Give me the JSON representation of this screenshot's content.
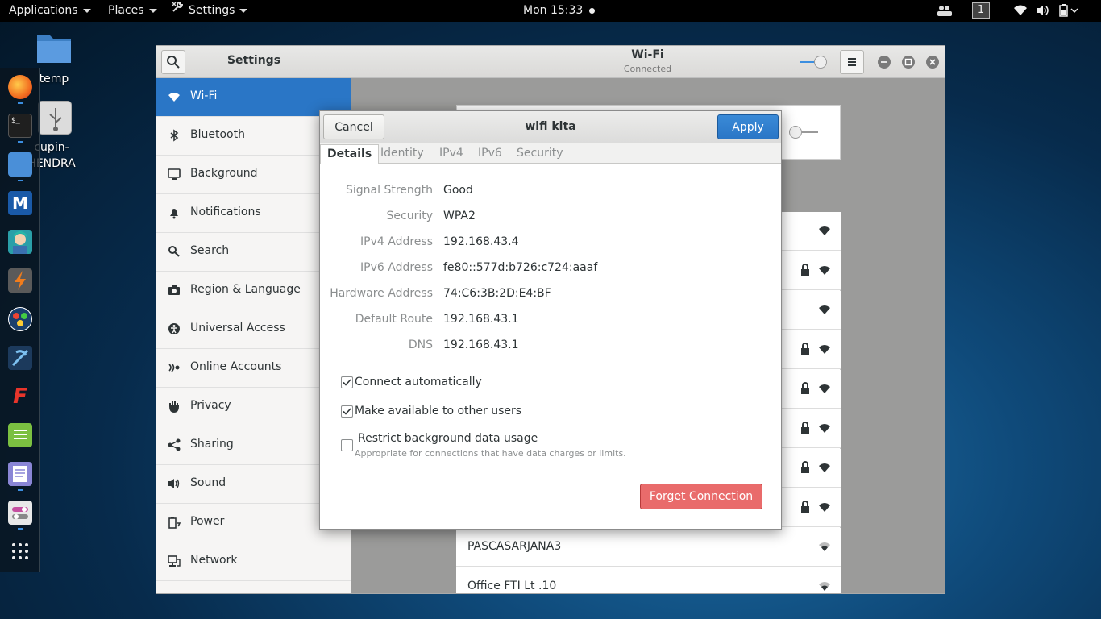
{
  "topbar": {
    "applications": "Applications",
    "places": "Places",
    "settings": "Settings",
    "clock": "Mon 15:33",
    "workspace": "1"
  },
  "desktop": {
    "icons": [
      {
        "label": "temp",
        "icon": "folder-icon"
      },
      {
        "label": "cupin-\nHENDRA",
        "icon": "usb-drive-icon"
      }
    ]
  },
  "dock": {
    "apps": [
      "firefox-icon",
      "terminal-icon",
      "files-icon",
      "metasploit-icon",
      "avatar-app-icon",
      "burp-icon",
      "maltego-icon",
      "kali-tool-icon",
      "faraday-icon",
      "notes-icon",
      "text-editor-icon",
      "tweaks-icon",
      "app-grid-icon"
    ]
  },
  "settings_window": {
    "sidebar_title": "Settings",
    "main_title": "Wi-Fi",
    "main_subtitle": "Connected",
    "sidebar_items": [
      {
        "label": "Wi-Fi",
        "icon": "wifi-icon",
        "active": true
      },
      {
        "label": "Bluetooth",
        "icon": "bluetooth-icon"
      },
      {
        "label": "Background",
        "icon": "background-icon"
      },
      {
        "label": "Notifications",
        "icon": "bell-icon"
      },
      {
        "label": "Search",
        "icon": "search-icon"
      },
      {
        "label": "Region & Language",
        "icon": "camera-icon"
      },
      {
        "label": "Universal Access",
        "icon": "accessibility-icon"
      },
      {
        "label": "Online Accounts",
        "icon": "online-accounts-icon"
      },
      {
        "label": "Privacy",
        "icon": "hand-icon"
      },
      {
        "label": "Sharing",
        "icon": "share-icon"
      },
      {
        "label": "Sound",
        "icon": "speaker-icon"
      },
      {
        "label": "Power",
        "icon": "power-icon"
      },
      {
        "label": "Network",
        "icon": "network-icon"
      }
    ],
    "networks": [
      {
        "label": "PASCASARJANA3"
      },
      {
        "label": "Office FTI Lt .10"
      }
    ]
  },
  "dialog": {
    "title": "wifi kita",
    "cancel": "Cancel",
    "apply": "Apply",
    "tabs": [
      "Details",
      "Identity",
      "IPv4",
      "IPv6",
      "Security"
    ],
    "active_tab": "Details",
    "details": [
      {
        "key": "Signal Strength",
        "value": "Good"
      },
      {
        "key": "Security",
        "value": "WPA2"
      },
      {
        "key": "IPv4 Address",
        "value": "192.168.43.4"
      },
      {
        "key": "IPv6 Address",
        "value": "fe80::577d:b726:c724:aaaf"
      },
      {
        "key": "Hardware Address",
        "value": "74:C6:3B:2D:E4:BF"
      },
      {
        "key": "Default Route",
        "value": "192.168.43.1"
      },
      {
        "key": "DNS",
        "value": "192.168.43.1"
      }
    ],
    "options": [
      {
        "label": "Connect automatically",
        "checked": true
      },
      {
        "label": "Make available to other users",
        "checked": true
      },
      {
        "label": "Restrict background data usage",
        "checked": false,
        "hint": "Appropriate for connections that have data charges or limits."
      }
    ],
    "forget": "Forget Connection"
  },
  "colors": {
    "accent": "#2a76c6",
    "destructive": "#e96b6b"
  }
}
